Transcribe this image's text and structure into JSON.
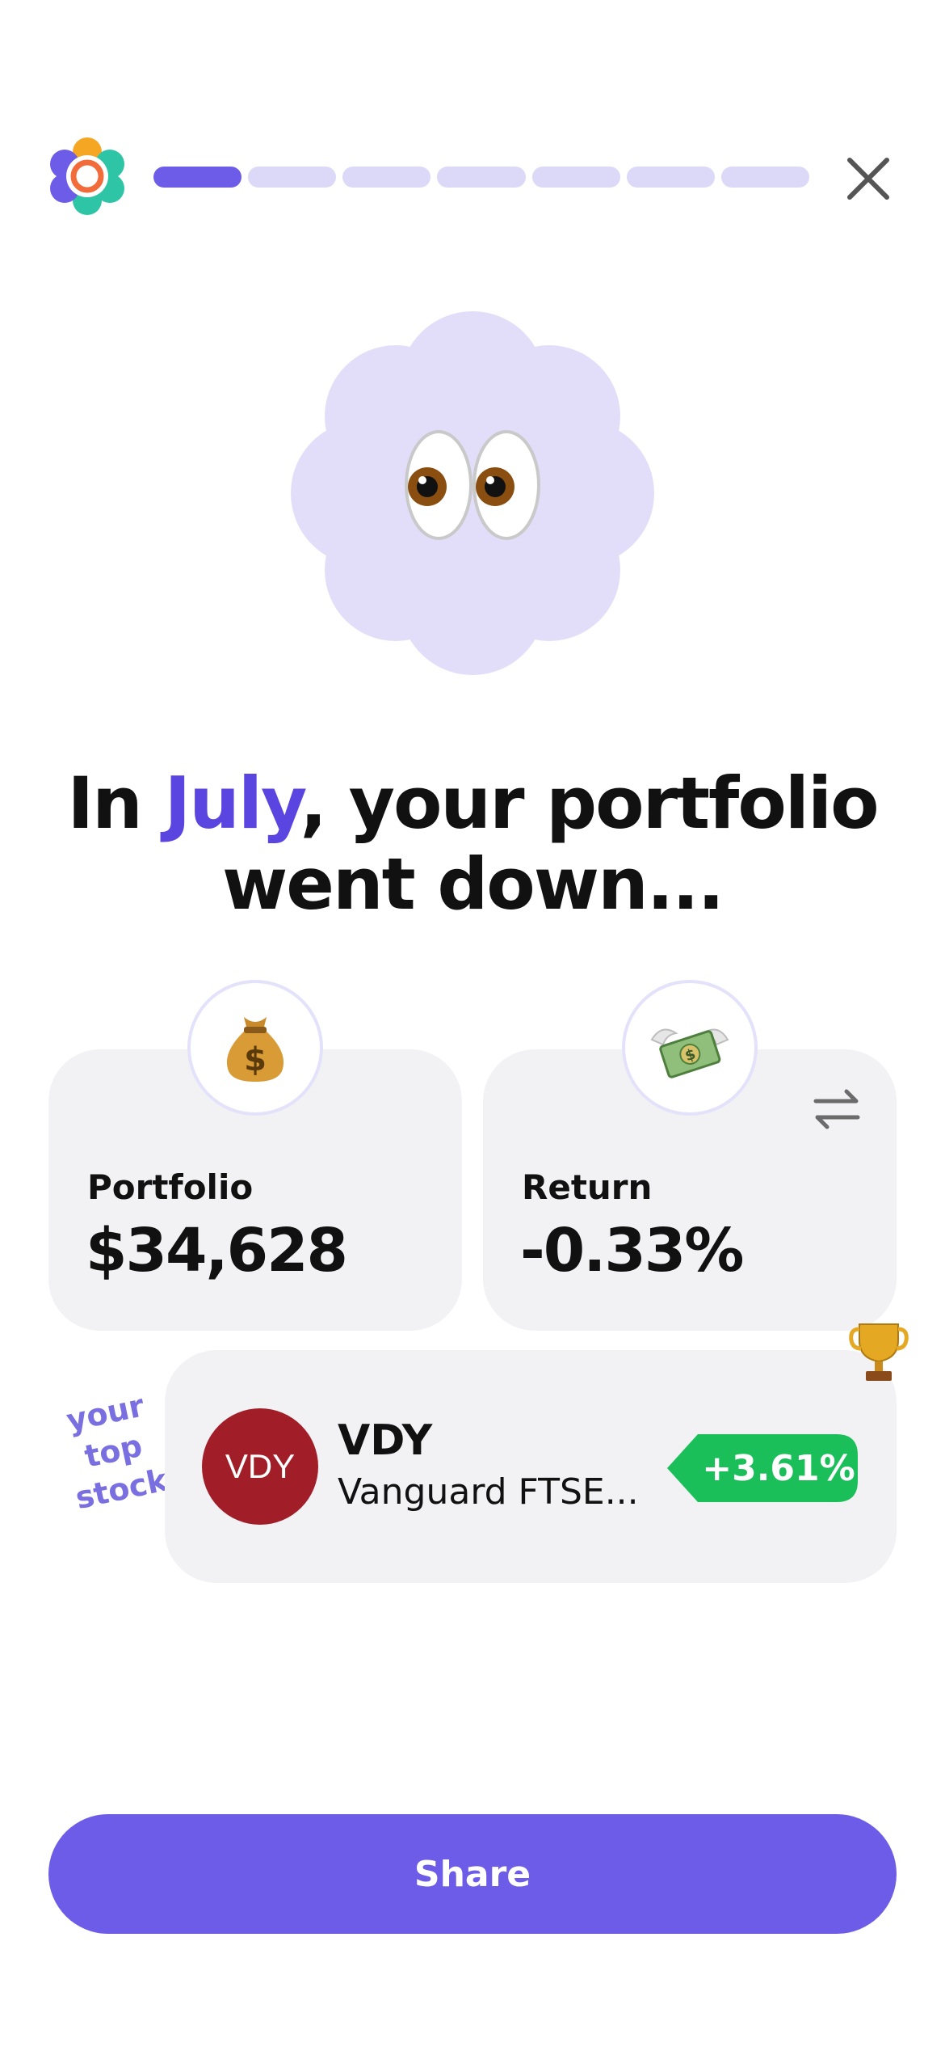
{
  "header": {
    "progress_total": 7,
    "progress_current": 1,
    "logo_icon": "flower-logo-icon",
    "close_icon": "close-icon"
  },
  "hero": {
    "icon": "eyes-emoji"
  },
  "heading": {
    "prefix": "In ",
    "month": "July",
    "suffix": ", your portfolio",
    "line2": "went down..."
  },
  "portfolio_card": {
    "icon": "money-bag-emoji",
    "label": "Portfolio",
    "value": "$34,628"
  },
  "return_card": {
    "icon": "money-with-wings-emoji",
    "label": "Return",
    "value": "-0.33%",
    "action_icon": "swap-arrows-icon"
  },
  "top_stock": {
    "note_line1": "your",
    "note_line2": "top",
    "note_line3": "stock",
    "logo_text": "VDY",
    "ticker": "VDY",
    "name": "Vanguard FTSE...",
    "change": "+3.61%",
    "trophy_icon": "trophy-emoji"
  },
  "footer": {
    "share_label": "Share"
  },
  "colors": {
    "accent": "#6c5ce7",
    "highlight": "#5a45e0",
    "progress_inactive": "#dcd8f8",
    "card_bg": "#f2f2f5",
    "hero_bg": "#e2defa",
    "positive": "#1bbf5a",
    "stock_logo_bg": "#a11d28",
    "note": "#7a6fe0"
  }
}
